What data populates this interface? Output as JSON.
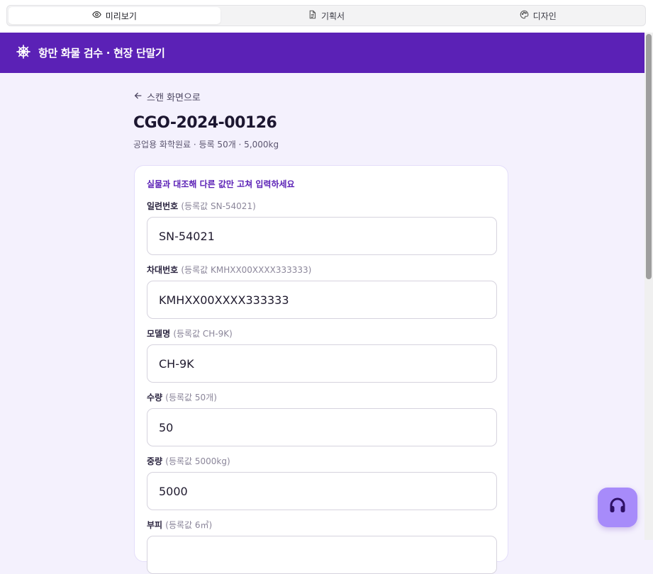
{
  "tabs": [
    {
      "label": "미리보기",
      "icon": "eye-icon",
      "active": true
    },
    {
      "label": "기획서",
      "icon": "document-icon",
      "active": false
    },
    {
      "label": "디자인",
      "icon": "palette-icon",
      "active": false
    }
  ],
  "header": {
    "title": "항만 화물 검수 · 현장 단말기",
    "icon": "ship-wheel-icon",
    "color": "#5b21b6"
  },
  "back_link": "스캔 화면으로",
  "cargo": {
    "id": "CGO-2024-00126",
    "summary": "공업용 화학원료 · 등록 50개 · 5,000kg"
  },
  "form": {
    "hint": "실물과 대조해 다른 값만 고쳐 입력하세요",
    "fields": [
      {
        "label": "일련번호",
        "registered": "(등록값 SN-54021)",
        "value": "SN-54021"
      },
      {
        "label": "차대번호",
        "registered": "(등록값 KMHXX00XXXX333333)",
        "value": "KMHXX00XXXX333333"
      },
      {
        "label": "모델명",
        "registered": "(등록값 CH-9K)",
        "value": "CH-9K"
      },
      {
        "label": "수량",
        "registered": "(등록값 50개)",
        "value": "50"
      },
      {
        "label": "중량",
        "registered": "(등록값 5000kg)",
        "value": "5000"
      },
      {
        "label": "부피",
        "registered": "(등록값 6㎥)",
        "value": ""
      }
    ]
  },
  "help_button": {
    "icon": "headset-icon"
  }
}
